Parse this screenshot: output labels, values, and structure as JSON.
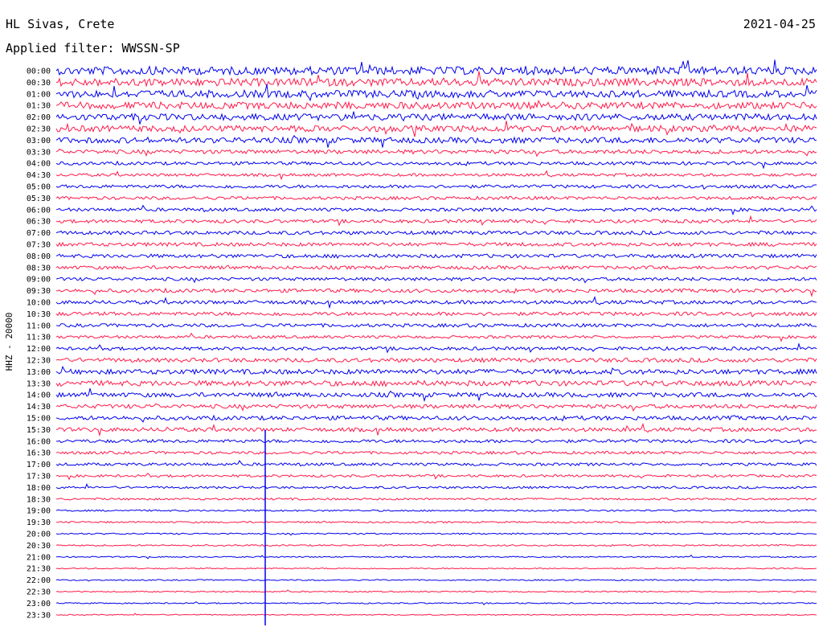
{
  "header": {
    "station": "HL Sivas, Crete",
    "date": "2021-04-25",
    "filter": "Applied filter: WWSSN-SP"
  },
  "chart_data": {
    "type": "line",
    "title": "HL Sivas, Crete",
    "date": "2021-04-25",
    "filter": "Applied filter: WWSSN-SP",
    "ylabel": "HHZ - 20000",
    "rows": [
      "00:00",
      "00:30",
      "01:00",
      "01:30",
      "02:00",
      "02:30",
      "03:00",
      "03:30",
      "04:00",
      "04:30",
      "05:00",
      "05:30",
      "06:00",
      "06:30",
      "07:00",
      "07:30",
      "08:00",
      "08:30",
      "09:00",
      "09:30",
      "10:00",
      "10:30",
      "11:00",
      "11:30",
      "12:00",
      "12:30",
      "13:00",
      "13:30",
      "14:00",
      "14:30",
      "15:00",
      "15:30",
      "16:00",
      "16:30",
      "17:00",
      "17:30",
      "18:00",
      "18:30",
      "19:00",
      "19:30",
      "20:00",
      "20:30",
      "21:00",
      "21:30",
      "22:00",
      "22:30",
      "23:00",
      "23:30"
    ],
    "series_colors": [
      "#0000ee",
      "#ff1a4a"
    ],
    "noise_level": [
      1.0,
      0.95,
      0.9,
      0.85,
      0.8,
      0.75,
      0.7,
      0.5,
      0.4,
      0.35,
      0.4,
      0.4,
      0.4,
      0.42,
      0.45,
      0.45,
      0.45,
      0.42,
      0.4,
      0.45,
      0.45,
      0.45,
      0.42,
      0.35,
      0.4,
      0.5,
      0.6,
      0.65,
      0.55,
      0.5,
      0.5,
      0.48,
      0.4,
      0.35,
      0.35,
      0.3,
      0.28,
      0.25,
      0.2,
      0.2,
      0.18,
      0.18,
      0.15,
      0.15,
      0.15,
      0.15,
      0.15,
      0.12
    ]
  }
}
